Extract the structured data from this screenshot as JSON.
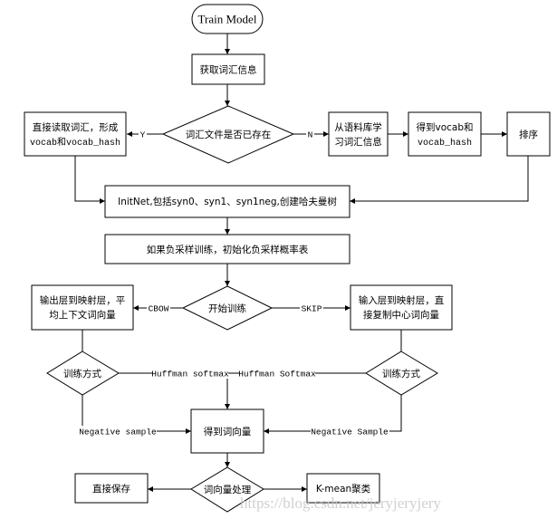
{
  "diagram": {
    "type": "flowchart",
    "nodes": {
      "start": {
        "shape": "terminator",
        "lines": [
          "Train Model"
        ]
      },
      "get_vocab": {
        "shape": "process",
        "lines": [
          "获取词汇信息"
        ]
      },
      "vocab_exists": {
        "shape": "decision",
        "lines": [
          "词汇文件是否已存在"
        ]
      },
      "read_vocab": {
        "shape": "process",
        "lines": [
          "直接读取词汇，形成",
          "vocab和vocab_hash"
        ]
      },
      "learn_vocab": {
        "shape": "process",
        "lines": [
          "从语料库学",
          "习词汇信息"
        ]
      },
      "got_vocab": {
        "shape": "process",
        "lines": [
          "得到vocab和",
          "vocab_hash"
        ]
      },
      "sort": {
        "shape": "process",
        "lines": [
          "排序"
        ]
      },
      "init_net": {
        "shape": "process",
        "lines": [
          "InitNet,包括syn0、syn1、syn1neg,创建哈夫曼树"
        ]
      },
      "init_neg": {
        "shape": "process",
        "lines": [
          "如果负采样训练，初始化负采样概率表"
        ]
      },
      "start_train": {
        "shape": "decision",
        "lines": [
          "开始训练"
        ]
      },
      "cbow": {
        "shape": "process",
        "lines": [
          "输出层到映射层，平",
          "均上下文词向量"
        ]
      },
      "skip": {
        "shape": "process",
        "lines": [
          "输入层到映射层，直",
          "接复制中心词向量"
        ]
      },
      "method_left": {
        "shape": "decision",
        "lines": [
          "训练方式"
        ]
      },
      "method_right": {
        "shape": "decision",
        "lines": [
          "训练方式"
        ]
      },
      "word_vec": {
        "shape": "process",
        "lines": [
          "得到词向量"
        ]
      },
      "vec_process": {
        "shape": "decision",
        "lines": [
          "词向量处理"
        ]
      },
      "save": {
        "shape": "process",
        "lines": [
          "直接保存"
        ]
      },
      "kmean": {
        "shape": "process",
        "lines": [
          "K-mean聚类"
        ]
      }
    },
    "edges": [
      {
        "from": "start",
        "to": "get_vocab",
        "label": ""
      },
      {
        "from": "get_vocab",
        "to": "vocab_exists",
        "label": ""
      },
      {
        "from": "vocab_exists",
        "to": "read_vocab",
        "label": "Y"
      },
      {
        "from": "vocab_exists",
        "to": "learn_vocab",
        "label": "N"
      },
      {
        "from": "learn_vocab",
        "to": "got_vocab",
        "label": ""
      },
      {
        "from": "got_vocab",
        "to": "sort",
        "label": ""
      },
      {
        "from": "read_vocab",
        "to": "init_net",
        "label": ""
      },
      {
        "from": "sort",
        "to": "init_net",
        "label": ""
      },
      {
        "from": "init_net",
        "to": "init_neg",
        "label": ""
      },
      {
        "from": "init_neg",
        "to": "start_train",
        "label": ""
      },
      {
        "from": "start_train",
        "to": "cbow",
        "label": "CBOW"
      },
      {
        "from": "start_train",
        "to": "skip",
        "label": "SKIP"
      },
      {
        "from": "cbow",
        "to": "method_left",
        "label": ""
      },
      {
        "from": "skip",
        "to": "method_right",
        "label": ""
      },
      {
        "from": "method_left",
        "to": "word_vec",
        "label": "Huffman softmax"
      },
      {
        "from": "method_right",
        "to": "word_vec",
        "label": "Huffman Softmax"
      },
      {
        "from": "method_left",
        "to": "word_vec",
        "label": "Negative sample"
      },
      {
        "from": "method_right",
        "to": "word_vec",
        "label": "Negative Sample"
      },
      {
        "from": "word_vec",
        "to": "vec_process",
        "label": ""
      },
      {
        "from": "vec_process",
        "to": "save",
        "label": ""
      },
      {
        "from": "vec_process",
        "to": "kmean",
        "label": ""
      }
    ]
  },
  "watermark": "https://blog.csdn.net/jeryjeryjery"
}
